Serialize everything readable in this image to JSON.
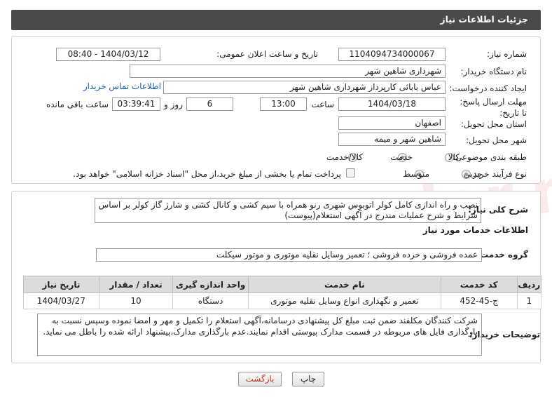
{
  "header": {
    "title": "جزئیات اطلاعات نیاز"
  },
  "form": {
    "need_number_label": "شماره نیاز:",
    "need_number": "1104094734000067",
    "announce_label": "تاریخ و ساعت اعلان عمومی:",
    "announce_value": "1404/03/12 - 08:40",
    "buyer_org_label": "نام دستگاه خریدار:",
    "buyer_org": "شهرداری شاهین شهر",
    "requester_label": "ایجاد کننده درخواست:",
    "requester": "عباس بابائی کارپرداز شهرداری شاهین شهر",
    "contact_link": "اطلاعات تماس خریدار",
    "deadline_label": "مهلت ارسال پاسخ: تا تاریخ:",
    "deadline_date": "1404/03/18",
    "hour_label": "ساعت",
    "deadline_hour": "13:00",
    "days_value": "6",
    "days_label": "روز و",
    "remaining_time": "03:39:41",
    "remaining_label": "ساعت باقی مانده",
    "province_label": "استان محل تحویل:",
    "province": "اصفهان",
    "city_label": "شهر محل تحویل:",
    "city": "شاهین شهر و میمه",
    "category_label": "طبقه بندی موضوعی:",
    "category_options": [
      "کالا",
      "خدمت",
      "کالا/خدمت"
    ],
    "category_selected": "خدمت",
    "process_label": "نوع فرآیند خرید :",
    "process_options": [
      "جزیی",
      "متوسط"
    ],
    "process_selected": "متوسط",
    "payment_note": "پرداخت تمام یا بخشی از مبلغ خرید،از محل \"اسناد خزانه اسلامی\" خواهد بود."
  },
  "description": {
    "label": "شرح کلی نیاز:",
    "text": "نصب و راه اندازی کامل کولر اتوبوس شهری رنو همراه با سیم کشی و کانال کشی و شارژ گاز کولر بر اساس شرایط و شرح عملیات مندرج در آگهی استعلام(پیوست)"
  },
  "services": {
    "section_title": "اطلاعات خدمات مورد نیاز",
    "group_label": "گروه خدمت:",
    "group_value": "عمده فروشی و خرده فروشی ؛ تعمیر وسایل نقلیه موتوری و موتور سیکلت",
    "columns": [
      "ردیف",
      "کد خدمت",
      "نام خدمت",
      "واحد اندازه گیری",
      "تعداد / مقدار",
      "تاریخ نیاز"
    ],
    "rows": [
      [
        "1",
        "ج-45-452",
        "تعمیر و نگهداری انواع وسایل نقلیه موتوری",
        "دستگاه",
        "10",
        "1404/03/27"
      ]
    ]
  },
  "buyer_notes": {
    "label": "توضیحات خریدار:",
    "text": "شرکت کنندگان مکلفند ضمن ثبت مبلغ کل پیشنهادی درسامانه،آگهی استعلام را  تکمیل و مهر و امضا نموده وسپس نسبت به بارگذاری فایل های مربوطه در قسمت مدارک پیوستی اقدام نمایند.عدم بارگذاری مدارک،پیشنهاد ارائه شده را باطل می نماید."
  },
  "buttons": {
    "print": "چاپ",
    "back": "بازگشت"
  },
  "colors": {
    "header_bg": "#4a4a4a",
    "link": "#1a5fb4",
    "back_text": "#c0392b"
  }
}
